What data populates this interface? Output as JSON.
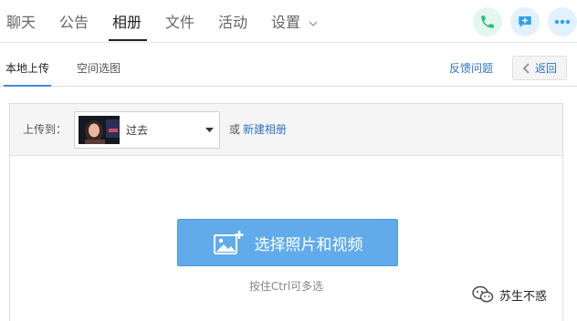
{
  "top_tabs": [
    {
      "label": "聊天",
      "active": false
    },
    {
      "label": "公告",
      "active": false
    },
    {
      "label": "相册",
      "active": true
    },
    {
      "label": "文件",
      "active": false
    },
    {
      "label": "活动",
      "active": false
    },
    {
      "label": "设置",
      "active": false,
      "has_dropdown": true
    }
  ],
  "top_actions": [
    {
      "icon": "phone-icon",
      "color": "#27c07a"
    },
    {
      "icon": "chat-add-icon",
      "color": "#2ea1f0"
    },
    {
      "icon": "more-icon",
      "color": "#2ea1f0"
    }
  ],
  "sub_tabs": [
    {
      "label": "本地上传",
      "active": true
    },
    {
      "label": "空间选图",
      "active": false
    }
  ],
  "header_links": {
    "feedback": "反馈问题",
    "back": "返回"
  },
  "upload_panel": {
    "upload_to_label": "上传到：",
    "album_selected": "过去",
    "or_text": "或",
    "new_album_link": "新建相册",
    "upload_button_label": "选择照片和视频",
    "hint": "按住Ctrl可多选"
  },
  "watermark": {
    "text": "苏生不惑"
  },
  "colors": {
    "accent_blue": "#2f74c4",
    "upload_button": "#62abea",
    "active_underline": "#3a8ee6"
  }
}
